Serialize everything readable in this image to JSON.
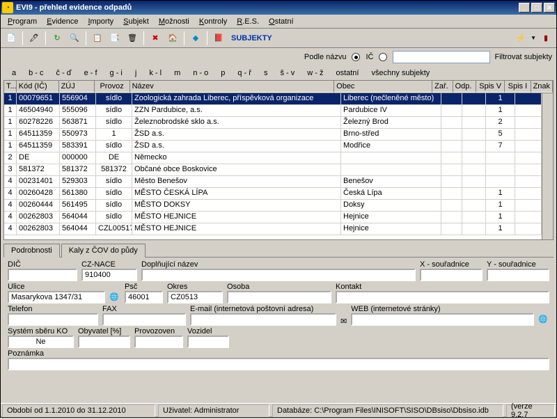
{
  "title": "EVI9 - přehled evidence odpadů",
  "menu": [
    "Program",
    "Evidence",
    "Importy",
    "Subjekt",
    "Možnosti",
    "Kontroly",
    "R.E.S.",
    "Ostatní"
  ],
  "subjekty_label": "SUBJEKTY",
  "filter": {
    "podle_nazvu": "Podle názvu",
    "ic": "IČ",
    "value": "",
    "button": "Filtrovat subjekty"
  },
  "alpha": [
    "a",
    "b - c",
    "č - ď",
    "e - f",
    "g - i",
    "j",
    "k - l",
    "m",
    "n - o",
    "p",
    "q - ř",
    "s",
    "š - v",
    "w - ž",
    "ostatní",
    "všechny subjekty"
  ],
  "columns": [
    "T...",
    "Kód (IČ)",
    "ZÚJ",
    "Provoz",
    "Název",
    "Obec",
    "Zař.",
    "Odp.",
    "Spis V",
    "Spis I",
    "Znak"
  ],
  "rows": [
    {
      "t": "1",
      "kod": "00079651",
      "zuj": "556904",
      "provoz": "sídlo",
      "nazev": "Zoologická zahrada Liberec, příspěvková organizace",
      "obec": "Liberec (nečleněné město)",
      "zar": "",
      "odp": "",
      "spisv": "1",
      "spisi": "",
      "sel": true
    },
    {
      "t": "1",
      "kod": "46504940",
      "zuj": "555096",
      "provoz": "sídlo",
      "nazev": "ZZN Pardubice, a.s.",
      "obec": "Pardubice IV",
      "spisv": "1"
    },
    {
      "t": "1",
      "kod": "60278226",
      "zuj": "563871",
      "provoz": "sídlo",
      "nazev": "Železnobrodské sklo a.s.",
      "obec": "Železný Brod",
      "spisv": "2"
    },
    {
      "t": "1",
      "kod": "64511359",
      "zuj": "550973",
      "provoz": "1",
      "nazev": "ŽSD a.s.",
      "obec": "Brno-střed",
      "spisv": "5"
    },
    {
      "t": "1",
      "kod": "64511359",
      "zuj": "583391",
      "provoz": "sídlo",
      "nazev": "ŽSD a.s.",
      "obec": "Modřice",
      "spisv": "7"
    },
    {
      "t": "2",
      "kod": "DE",
      "zuj": "000000",
      "provoz": "DE",
      "nazev": "Německo",
      "obec": ""
    },
    {
      "t": "3",
      "kod": "581372",
      "zuj": "581372",
      "provoz": "581372",
      "nazev": "Občané obce Boskovice",
      "obec": ""
    },
    {
      "t": "4",
      "kod": "00231401",
      "zuj": "529303",
      "provoz": "sídlo",
      "nazev": "Město Benešov",
      "obec": "Benešov"
    },
    {
      "t": "4",
      "kod": "00260428",
      "zuj": "561380",
      "provoz": "sídlo",
      "nazev": "MĚSTO ČESKÁ LÍPA",
      "obec": "Česká Lípa",
      "spisv": "1"
    },
    {
      "t": "4",
      "kod": "00260444",
      "zuj": "561495",
      "provoz": "sídlo",
      "nazev": "MĚSTO DOKSY",
      "obec": "Doksy",
      "spisv": "1"
    },
    {
      "t": "4",
      "kod": "00262803",
      "zuj": "564044",
      "provoz": "sídlo",
      "nazev": "MĚSTO HEJNICE",
      "obec": "Hejnice",
      "spisv": "1"
    },
    {
      "t": "4",
      "kod": "00262803",
      "zuj": "564044",
      "provoz": "CZL00517",
      "nazev": "MĚSTO HEJNICE",
      "obec": "Hejnice",
      "spisv": "1"
    }
  ],
  "tabs": [
    "Podrobnosti",
    "Kaly z ČOV do půdy"
  ],
  "detail": {
    "labels": {
      "dic": "DIČ",
      "cznace": "CZ-NACE",
      "dopl": "Doplňující název",
      "xs": "X - souřadnice",
      "ys": "Y - souřadnice",
      "ulice": "Ulice",
      "psc": "Psč",
      "okres": "Okres",
      "osoba": "Osoba",
      "kontakt": "Kontakt",
      "telefon": "Telefon",
      "fax": "FAX",
      "email": "E-mail (internetová poštovní adresa)",
      "web": "WEB (internetové stránky)",
      "system": "Systém sběru KO",
      "obyv": "Obyvatel [%]",
      "provozoven": "Provozoven",
      "vozidel": "Vozidel",
      "poznamka": "Poznámka"
    },
    "values": {
      "dic": "",
      "cznace": "910400",
      "dopl": "",
      "xs": "",
      "ys": "",
      "ulice": "Masarykova 1347/31",
      "psc": "46001",
      "okres": "CZ0513",
      "osoba": "",
      "kontakt": "",
      "telefon": "",
      "fax": "",
      "email": "",
      "web": "",
      "system": "Ne",
      "obyv": "",
      "provozoven": "",
      "vozidel": "",
      "poznamka": ""
    }
  },
  "status": {
    "obdobi": "Období od 1.1.2010 do 31.12.2010",
    "uzivatel": "Uživatel: Administrator",
    "db": "Databáze: C:\\Program Files\\INISOFT\\SISO\\DBsiso\\Dbsiso.idb",
    "verze": "(verze 9.2.7"
  }
}
